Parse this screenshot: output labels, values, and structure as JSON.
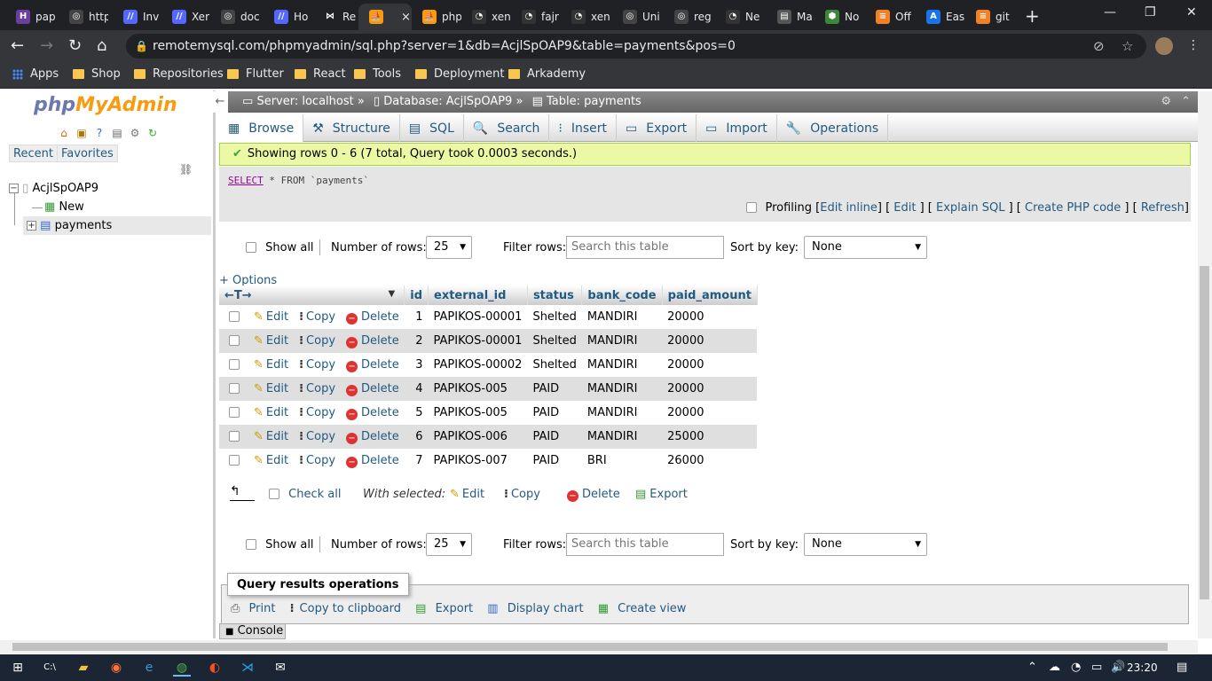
{
  "browser": {
    "tabs": [
      {
        "title": "pap",
        "icon_color": "#6b3fa0",
        "icon_text": "H"
      },
      {
        "title": "http",
        "icon_color": "#444",
        "icon_text": "◎"
      },
      {
        "title": "Inv",
        "icon_color": "#5468ff",
        "icon_text": "//"
      },
      {
        "title": "Xer",
        "icon_color": "#5468ff",
        "icon_text": "//"
      },
      {
        "title": "doc",
        "icon_color": "#444",
        "icon_text": "◎"
      },
      {
        "title": "Ho",
        "icon_color": "#5468ff",
        "icon_text": "//"
      },
      {
        "title": "Re",
        "icon_color": "#202124",
        "icon_text": "⋈"
      },
      {
        "title": "",
        "icon_color": "#f89c0e",
        "icon_text": "⛵",
        "active": true
      },
      {
        "title": "php",
        "icon_color": "#f89c0e",
        "icon_text": "⛵"
      },
      {
        "title": "xen",
        "icon_color": "#333",
        "icon_text": "◔"
      },
      {
        "title": "fajr",
        "icon_color": "#333",
        "icon_text": "◔"
      },
      {
        "title": "xen",
        "icon_color": "#333",
        "icon_text": "◔"
      },
      {
        "title": "Uni",
        "icon_color": "#444",
        "icon_text": "◎"
      },
      {
        "title": "reg",
        "icon_color": "#444",
        "icon_text": "◎"
      },
      {
        "title": "Ne",
        "icon_color": "#333",
        "icon_text": "◔"
      },
      {
        "title": "Ma",
        "icon_color": "#555",
        "icon_text": "▤"
      },
      {
        "title": "No",
        "icon_color": "#3c873a",
        "icon_text": "⬢"
      },
      {
        "title": "Off",
        "icon_color": "#f48024",
        "icon_text": "≡"
      },
      {
        "title": "Eas",
        "icon_color": "#1a73e8",
        "icon_text": "A"
      },
      {
        "title": "git",
        "icon_color": "#f48024",
        "icon_text": "≡"
      }
    ],
    "tab_close": "×",
    "new_tab": "+",
    "window_controls": [
      "—",
      "❐",
      "✕"
    ],
    "nav": {
      "back": "←",
      "forward": "→",
      "reload": "↻",
      "home": "⌂"
    },
    "url": "remotemysql.com/phpmyadmin/sql.php?server=1&db=AcjlSpOAP9&table=payments&pos=0",
    "bookmarks": [
      "Apps",
      "Shop",
      "Repositories",
      "Flutter",
      "React",
      "Tools",
      "Deployment",
      "Arkademy"
    ]
  },
  "sidebar": {
    "logo_part1": "php",
    "logo_part2": "MyAdmin",
    "tabs": [
      "Recent",
      "Favorites"
    ],
    "tree": {
      "db": "AcjlSpOAP9",
      "new": "New",
      "table": "payments"
    }
  },
  "breadcrumb": {
    "server": "Server: localhost »",
    "database": "Database: AcjlSpOAP9 »",
    "table": "Table: payments"
  },
  "menu": [
    {
      "label": "Browse",
      "icon": "▦",
      "active": true
    },
    {
      "label": "Structure",
      "icon": "⚒"
    },
    {
      "label": "SQL",
      "icon": "▤"
    },
    {
      "label": "Search",
      "icon": "🔍"
    },
    {
      "label": "Insert",
      "icon": "⁝"
    },
    {
      "label": "Export",
      "icon": "▭"
    },
    {
      "label": "Import",
      "icon": "▭"
    },
    {
      "label": "Operations",
      "icon": "🔧"
    }
  ],
  "message": "Showing rows 0 - 6 (7 total, Query took 0.0003 seconds.)",
  "sql": {
    "keyword": "SELECT",
    "rest": " * FROM `payments`",
    "profiling": "Profiling",
    "links": [
      "Edit inline",
      "Edit",
      "Explain SQL",
      "Create PHP code",
      "Refresh"
    ]
  },
  "controls": {
    "show_all": "Show all",
    "rows_label": "Number of rows:",
    "rows_value": "25",
    "filter_label": "Filter rows:",
    "filter_placeholder": "Search this table",
    "sort_label": "Sort by key:",
    "sort_value": "None"
  },
  "options_link": "+ Options",
  "table": {
    "columns": [
      "id",
      "external_id",
      "status",
      "bank_code",
      "paid_amount"
    ],
    "actions": {
      "edit": "Edit",
      "copy": "Copy",
      "delete": "Delete"
    },
    "rows": [
      {
        "id": "1",
        "external_id": "PAPIKOS-00001",
        "status": "Shelted",
        "bank_code": "MANDIRI",
        "paid_amount": "20000"
      },
      {
        "id": "2",
        "external_id": "PAPIKOS-00001",
        "status": "Shelted",
        "bank_code": "MANDIRI",
        "paid_amount": "20000"
      },
      {
        "id": "3",
        "external_id": "PAPIKOS-00002",
        "status": "Shelted",
        "bank_code": "MANDIRI",
        "paid_amount": "20000"
      },
      {
        "id": "4",
        "external_id": "PAPIKOS-005",
        "status": "PAID",
        "bank_code": "MANDIRI",
        "paid_amount": "20000"
      },
      {
        "id": "5",
        "external_id": "PAPIKOS-005",
        "status": "PAID",
        "bank_code": "MANDIRI",
        "paid_amount": "20000"
      },
      {
        "id": "6",
        "external_id": "PAPIKOS-006",
        "status": "PAID",
        "bank_code": "MANDIRI",
        "paid_amount": "25000"
      },
      {
        "id": "7",
        "external_id": "PAPIKOS-007",
        "status": "PAID",
        "bank_code": "BRI",
        "paid_amount": "26000"
      }
    ]
  },
  "with_selected": {
    "check_all": "Check all",
    "label": "With selected:",
    "edit": "Edit",
    "copy": "Copy",
    "delete": "Delete",
    "export": "Export"
  },
  "query_ops": {
    "title": "Query results operations",
    "links": [
      "Print",
      "Copy to clipboard",
      "Export",
      "Display chart",
      "Create view"
    ]
  },
  "console": "Console",
  "taskbar": {
    "time": "23:20"
  }
}
